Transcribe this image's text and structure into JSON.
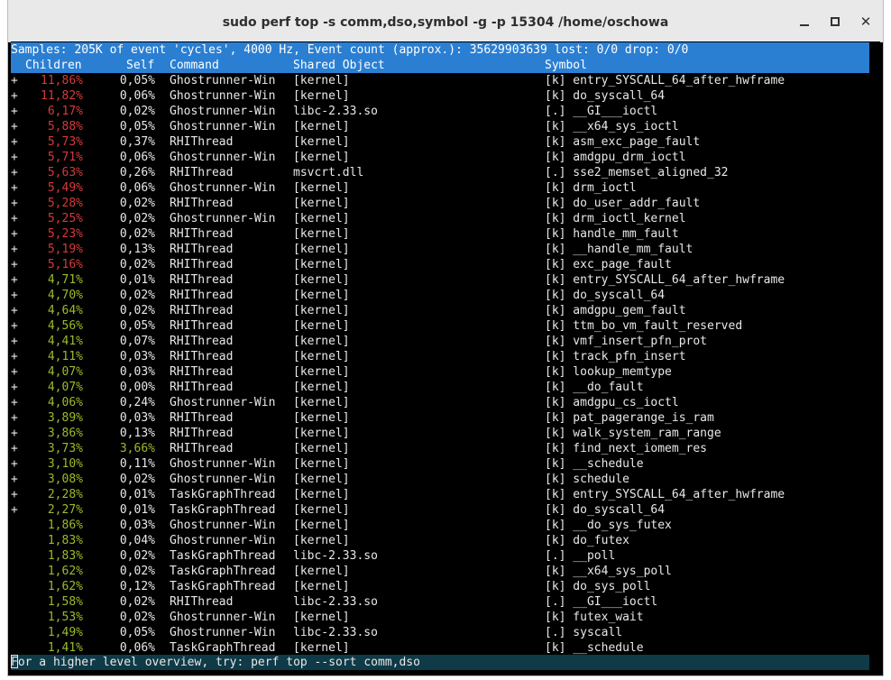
{
  "window": {
    "title": "sudo perf top -s comm,dso,symbol -g -p 15304 /home/oschowa",
    "minimize_label": "",
    "close_label": "✕"
  },
  "terminal": {
    "banner": "Samples: 205K of event 'cycles', 4000 Hz, Event count (approx.): 35629903639 lost: 0/0 drop: 0/0",
    "headers": {
      "children": "Children",
      "self": "Self",
      "command": "Command",
      "shared_object": "Shared Object",
      "symbol": "Symbol"
    },
    "rows": [
      {
        "exp": "+",
        "children": "11,86%",
        "self": "0,05%",
        "command": "Ghostrunner-Win",
        "dso": "[kernel]",
        "symbol": "[k] entry_SYSCALL_64_after_hwframe"
      },
      {
        "exp": "+",
        "children": "11,82%",
        "self": "0,06%",
        "command": "Ghostrunner-Win",
        "dso": "[kernel]",
        "symbol": "[k] do_syscall_64"
      },
      {
        "exp": "+",
        "children": "6,17%",
        "self": "0,02%",
        "command": "Ghostrunner-Win",
        "dso": "libc-2.33.so",
        "symbol": "[.] __GI___ioctl"
      },
      {
        "exp": "+",
        "children": "5,88%",
        "self": "0,05%",
        "command": "Ghostrunner-Win",
        "dso": "[kernel]",
        "symbol": "[k] __x64_sys_ioctl"
      },
      {
        "exp": "+",
        "children": "5,73%",
        "self": "0,37%",
        "command": "RHIThread",
        "dso": "[kernel]",
        "symbol": "[k] asm_exc_page_fault"
      },
      {
        "exp": "+",
        "children": "5,71%",
        "self": "0,06%",
        "command": "Ghostrunner-Win",
        "dso": "[kernel]",
        "symbol": "[k] amdgpu_drm_ioctl"
      },
      {
        "exp": "+",
        "children": "5,63%",
        "self": "0,26%",
        "command": "RHIThread",
        "dso": "msvcrt.dll",
        "symbol": "[.] sse2_memset_aligned_32"
      },
      {
        "exp": "+",
        "children": "5,49%",
        "self": "0,06%",
        "command": "Ghostrunner-Win",
        "dso": "[kernel]",
        "symbol": "[k] drm_ioctl"
      },
      {
        "exp": "+",
        "children": "5,28%",
        "self": "0,02%",
        "command": "RHIThread",
        "dso": "[kernel]",
        "symbol": "[k] do_user_addr_fault"
      },
      {
        "exp": "+",
        "children": "5,25%",
        "self": "0,02%",
        "command": "Ghostrunner-Win",
        "dso": "[kernel]",
        "symbol": "[k] drm_ioctl_kernel"
      },
      {
        "exp": "+",
        "children": "5,23%",
        "self": "0,02%",
        "command": "RHIThread",
        "dso": "[kernel]",
        "symbol": "[k] handle_mm_fault"
      },
      {
        "exp": "+",
        "children": "5,19%",
        "self": "0,13%",
        "command": "RHIThread",
        "dso": "[kernel]",
        "symbol": "[k] __handle_mm_fault"
      },
      {
        "exp": "+",
        "children": "5,16%",
        "self": "0,02%",
        "command": "RHIThread",
        "dso": "[kernel]",
        "symbol": "[k] exc_page_fault"
      },
      {
        "exp": "+",
        "children": "4,71%",
        "self": "0,01%",
        "command": "RHIThread",
        "dso": "[kernel]",
        "symbol": "[k] entry_SYSCALL_64_after_hwframe"
      },
      {
        "exp": "+",
        "children": "4,70%",
        "self": "0,02%",
        "command": "RHIThread",
        "dso": "[kernel]",
        "symbol": "[k] do_syscall_64"
      },
      {
        "exp": "+",
        "children": "4,64%",
        "self": "0,02%",
        "command": "RHIThread",
        "dso": "[kernel]",
        "symbol": "[k] amdgpu_gem_fault"
      },
      {
        "exp": "+",
        "children": "4,56%",
        "self": "0,05%",
        "command": "RHIThread",
        "dso": "[kernel]",
        "symbol": "[k] ttm_bo_vm_fault_reserved"
      },
      {
        "exp": "+",
        "children": "4,41%",
        "self": "0,07%",
        "command": "RHIThread",
        "dso": "[kernel]",
        "symbol": "[k] vmf_insert_pfn_prot"
      },
      {
        "exp": "+",
        "children": "4,11%",
        "self": "0,03%",
        "command": "RHIThread",
        "dso": "[kernel]",
        "symbol": "[k] track_pfn_insert"
      },
      {
        "exp": "+",
        "children": "4,07%",
        "self": "0,03%",
        "command": "RHIThread",
        "dso": "[kernel]",
        "symbol": "[k] lookup_memtype"
      },
      {
        "exp": "+",
        "children": "4,07%",
        "self": "0,00%",
        "command": "RHIThread",
        "dso": "[kernel]",
        "symbol": "[k] __do_fault"
      },
      {
        "exp": "+",
        "children": "4,06%",
        "self": "0,24%",
        "command": "Ghostrunner-Win",
        "dso": "[kernel]",
        "symbol": "[k] amdgpu_cs_ioctl"
      },
      {
        "exp": "+",
        "children": "3,89%",
        "self": "0,03%",
        "command": "RHIThread",
        "dso": "[kernel]",
        "symbol": "[k] pat_pagerange_is_ram"
      },
      {
        "exp": "+",
        "children": "3,86%",
        "self": "0,13%",
        "command": "RHIThread",
        "dso": "[kernel]",
        "symbol": "[k] walk_system_ram_range"
      },
      {
        "exp": "+",
        "children": "3,73%",
        "self": "3,66%",
        "command": "RHIThread",
        "dso": "[kernel]",
        "symbol": "[k] find_next_iomem_res"
      },
      {
        "exp": "+",
        "children": "3,10%",
        "self": "0,11%",
        "command": "Ghostrunner-Win",
        "dso": "[kernel]",
        "symbol": "[k] __schedule"
      },
      {
        "exp": "+",
        "children": "3,08%",
        "self": "0,02%",
        "command": "Ghostrunner-Win",
        "dso": "[kernel]",
        "symbol": "[k] schedule"
      },
      {
        "exp": "+",
        "children": "2,28%",
        "self": "0,01%",
        "command": "TaskGraphThread",
        "dso": "[kernel]",
        "symbol": "[k] entry_SYSCALL_64_after_hwframe"
      },
      {
        "exp": "+",
        "children": "2,27%",
        "self": "0,01%",
        "command": "TaskGraphThread",
        "dso": "[kernel]",
        "symbol": "[k] do_syscall_64"
      },
      {
        "exp": "",
        "children": "1,86%",
        "self": "0,03%",
        "command": "Ghostrunner-Win",
        "dso": "[kernel]",
        "symbol": "[k] __do_sys_futex"
      },
      {
        "exp": "",
        "children": "1,83%",
        "self": "0,04%",
        "command": "Ghostrunner-Win",
        "dso": "[kernel]",
        "symbol": "[k] do_futex"
      },
      {
        "exp": "",
        "children": "1,83%",
        "self": "0,02%",
        "command": "TaskGraphThread",
        "dso": "libc-2.33.so",
        "symbol": "[.] __poll"
      },
      {
        "exp": "",
        "children": "1,62%",
        "self": "0,02%",
        "command": "TaskGraphThread",
        "dso": "[kernel]",
        "symbol": "[k] __x64_sys_poll"
      },
      {
        "exp": "",
        "children": "1,62%",
        "self": "0,12%",
        "command": "TaskGraphThread",
        "dso": "[kernel]",
        "symbol": "[k] do_sys_poll"
      },
      {
        "exp": "",
        "children": "1,58%",
        "self": "0,02%",
        "command": "RHIThread",
        "dso": "libc-2.33.so",
        "symbol": "[.] __GI___ioctl"
      },
      {
        "exp": "",
        "children": "1,53%",
        "self": "0,02%",
        "command": "Ghostrunner-Win",
        "dso": "[kernel]",
        "symbol": "[k] futex_wait"
      },
      {
        "exp": "",
        "children": "1,49%",
        "self": "0,05%",
        "command": "Ghostrunner-Win",
        "dso": "libc-2.33.so",
        "symbol": "[.] syscall"
      },
      {
        "exp": "",
        "children": "1,41%",
        "self": "0,06%",
        "command": "TaskGraphThread",
        "dso": "[kernel]",
        "symbol": "[k] __schedule"
      }
    ],
    "status_line": "For a higher level overview, try: perf top --sort comm,dso",
    "colors": {
      "banner_bg": "#2a7fd3",
      "high_pct": "#d63a3a",
      "mid_pct": "#9bbb2b",
      "status_bg": "#0f3a47"
    }
  }
}
